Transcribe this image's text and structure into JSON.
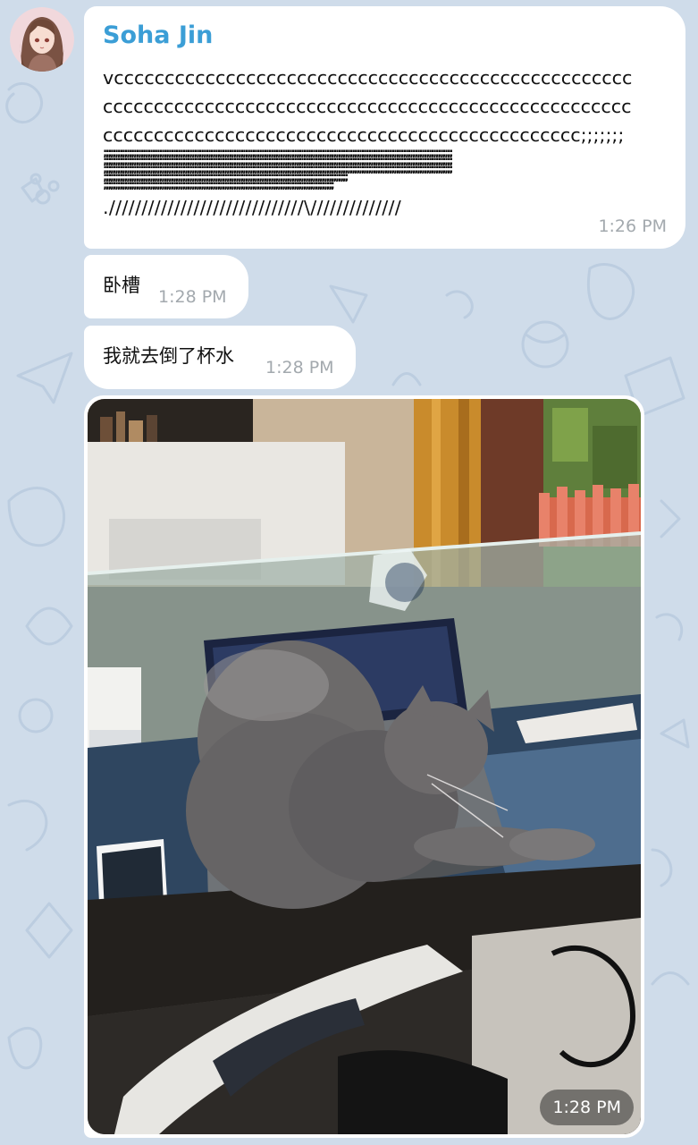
{
  "chat": {
    "messages": [
      {
        "sender": "Soha Jin",
        "lines": [
          "vccccccccccccccccccccccccccccccccccccccccccccccccccc",
          "cccccccccccccccccccccccccccccccccccccccccccccccccccc",
          "ccccccccccccccccccccccccccccccccccccccccccccccc;;;;;;;",
          ";;;;;;;;;;;;;;;;;;;;;;;;;;;;;;;;;;;;;;;;;;;;;;;;;;;;;;;;;;;;;;;;;;;;;;;;;;;;;;;;;;;;;;;;;;;;;;;;;;;;;;;;;;;;;;;;;;;;;;;;;;;;;;;;;;;;;;;;;;;;;;;;;;;;;;",
          ";;;;;;;;;;;;;;;;;;;;;;;;;;;;;;;;;;;;;;;;;;;;;;;;;;;;;;;;;;;;;;;;;;;;;;;;;;;;;;;;;;;;;;;;;;;;;;;;;;;;;;;;;;;;;;;;;;;;;;;;;;;;;;;;;;;;;;;;;;;;;;;;;;;;;;",
          ";;;;;;;;;;;;;;;;;;;;;;;;;;;;;;;;;;;;;;;;;;;;;;;;;;;;;;;;;;;;;;;;;;;;;;;;;;;;;;;;;;;;;;;;;;;;;;;;;;;;;;;;;;;;;;;;;;;;;;;;;;;;;;;;;;;;;;;;;;;;;;;;;;;;;;",
          ";;;;;;;;;;;;;;;;;;;;;;;;;;;;;;;;;;;;;;;;;;;;;;;;;;;;;;;;;;;;;;;;;;;;;;;;;;;;;;;;;;;;;;;;;;;;;;;;;;;;;;;;;",
          ";;;;;;;;;;;;;;;;;;;;;;;;;;;;;;;;;;;;;;;;;;;;;;;;;;;;;;;;;;;;;;;;;;;;;;;;;;;;;;;;;;;;;;;;;;;;;;;;;;;",
          ".//////////////////////////////\\//////////////"
        ],
        "time": "1:26 PM"
      },
      {
        "text": "卧槽",
        "time": "1:28 PM"
      },
      {
        "text": "我就去倒了杯水",
        "time": "1:28 PM"
      },
      {
        "photo_time": "1:28 PM"
      }
    ]
  },
  "icons": {
    "avatar": "avatar-anime-girl",
    "photo": "cat-on-laptop-photo"
  },
  "colors": {
    "wallpaper": "#cfdcea",
    "bubble": "#ffffff",
    "sender_name": "#3b9ed6",
    "timestamp": "#a3a9ae"
  }
}
